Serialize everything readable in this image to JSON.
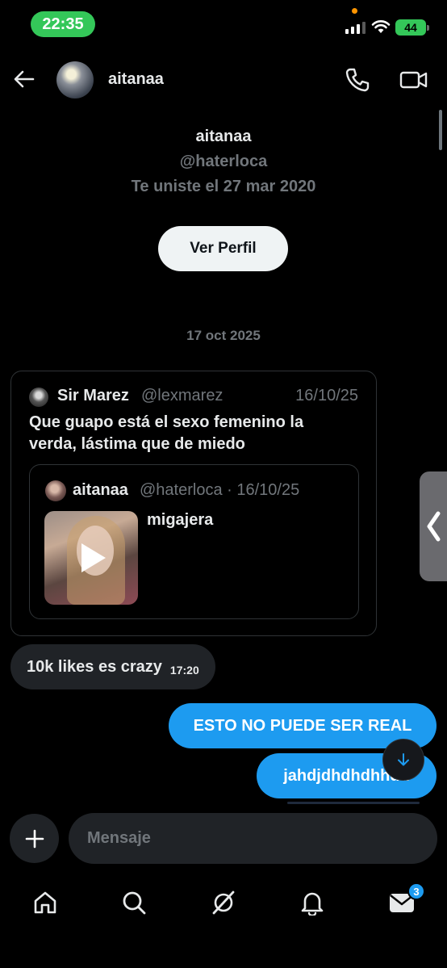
{
  "status_bar": {
    "time": "22:35",
    "battery": "44"
  },
  "header": {
    "name": "aitanaa"
  },
  "profile": {
    "name": "aitanaa",
    "handle": "@haterloca",
    "joined": "Te uniste el 27 mar 2020",
    "view_profile_label": "Ver Perfil"
  },
  "date_separator": "17 oct 2025",
  "shared_tweet": {
    "author_name": "Sir Marez",
    "author_handle": "@lexmarez",
    "date": "16/10/25",
    "text": "Que guapo está el sexo femenino la verda, lástima que de miedo",
    "quoted": {
      "author_name": "aitanaa",
      "meta": "@haterloca · 16/10/25",
      "text": "migajera"
    }
  },
  "messages": {
    "received": {
      "text": "10k likes es crazy",
      "time": "17:20"
    },
    "sent": [
      "ESTO NO PUEDE SER REAL",
      "jahdjdhdhdhhdd"
    ]
  },
  "composer": {
    "placeholder": "Mensaje"
  },
  "tabbar": {
    "items": [
      "home-icon",
      "search-icon",
      "grok-icon",
      "notifications-icon",
      "messages-icon"
    ],
    "messages_badge": "3"
  },
  "colors": {
    "accent": "#1d9bf0",
    "status_pill": "#34c759"
  }
}
